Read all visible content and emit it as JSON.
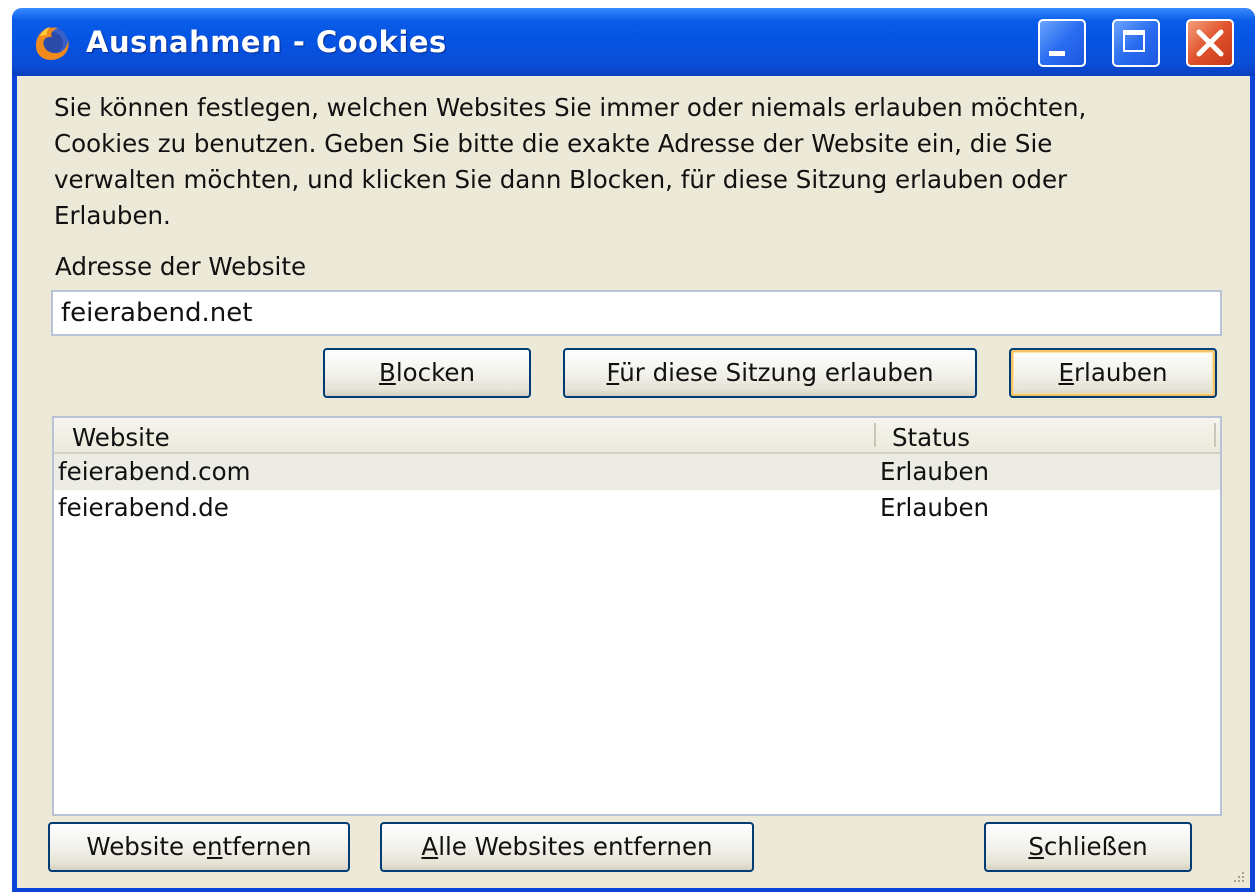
{
  "window": {
    "title": "Ausnahmen - Cookies"
  },
  "description": "Sie können festlegen, welchen Websites Sie immer oder niemals erlauben möchten, Cookies zu benutzen. Geben Sie bitte die exakte Adresse der Website ein, die Sie verwalten möchten, und klicken Sie dann Blocken, für diese Sitzung erlauben oder Erlauben.",
  "address": {
    "label": "Adresse der Website",
    "value": "feierabend.net"
  },
  "buttons": {
    "block": {
      "mnemonic": "B",
      "rest": "locken"
    },
    "session": {
      "mnemonic": "F",
      "rest": "ür diese Sitzung erlauben"
    },
    "allow": {
      "mnemonic": "E",
      "rest": "rlauben"
    },
    "remove": {
      "pre": "Website e",
      "mnemonic": "n",
      "rest": "tfernen"
    },
    "remove_all": {
      "mnemonic": "A",
      "rest": "lle Websites entfernen"
    },
    "close": {
      "mnemonic": "S",
      "rest": "chließen"
    }
  },
  "table": {
    "columns": [
      "Website",
      "Status"
    ],
    "rows": [
      {
        "site": "feierabend.com",
        "status": "Erlauben"
      },
      {
        "site": "feierabend.de",
        "status": "Erlauben"
      }
    ]
  },
  "colors": {
    "titlebar": "#0553e3",
    "client": "#ece9d8",
    "button_border": "#003c74",
    "close_button": "#e0512a"
  },
  "icons": [
    "firefox-icon",
    "minimize-icon",
    "maximize-icon",
    "close-icon",
    "resize-grip-icon"
  ]
}
